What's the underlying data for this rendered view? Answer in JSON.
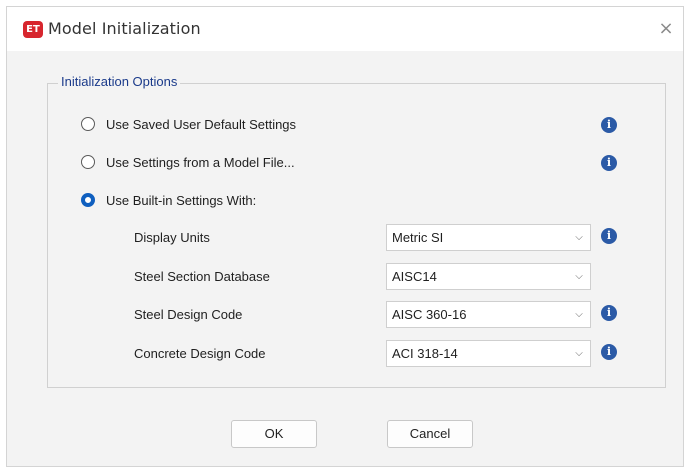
{
  "window": {
    "app_icon_text": "ET",
    "title": "Model Initialization",
    "close_glyph": "×"
  },
  "group": {
    "legend": "Initialization Options",
    "options": [
      {
        "label": "Use Saved User Default Settings",
        "selected": false,
        "has_info": true
      },
      {
        "label": "Use Settings from a Model File...",
        "selected": false,
        "has_info": true
      },
      {
        "label": "Use Built-in Settings With:",
        "selected": true,
        "has_info": false
      }
    ],
    "settings": [
      {
        "label": "Display Units",
        "value": "Metric SI",
        "has_info": true
      },
      {
        "label": "Steel Section Database",
        "value": "AISC14",
        "has_info": false
      },
      {
        "label": "Steel Design Code",
        "value": "AISC 360-16",
        "has_info": true
      },
      {
        "label": "Concrete Design Code",
        "value": "ACI 318-14",
        "has_info": true
      }
    ]
  },
  "icons": {
    "info": "info-icon",
    "chevron": "chevron-down-icon",
    "info_glyph": "i",
    "chevron_glyph": "⌵"
  },
  "buttons": {
    "ok": "OK",
    "cancel": "Cancel"
  },
  "colors": {
    "accent": "#0f5fbf",
    "info": "#2b5aa6",
    "logo": "#d7262e",
    "legend": "#1a3a8a"
  }
}
